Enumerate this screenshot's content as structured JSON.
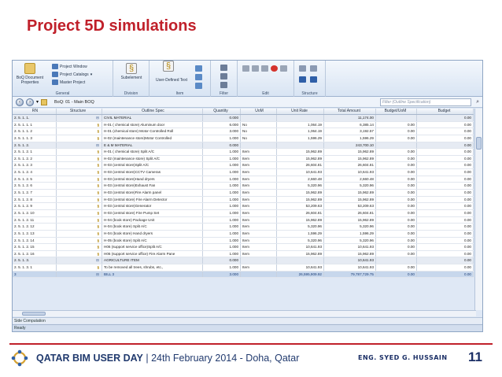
{
  "slide": {
    "title": "Project 5D simulations"
  },
  "ribbon": {
    "general": {
      "label": "General",
      "boq_props": "BoQ Document Properties",
      "project_window": "Project Window",
      "project_catalogs": "Project Catalogs",
      "master_project": "Master Project"
    },
    "division": {
      "label": "Division",
      "subelement": "Subelement"
    },
    "item": {
      "label": "Item",
      "user_defined": "User-Defined Text"
    },
    "filter": {
      "label": "Filter"
    },
    "edit": {
      "label": "Edit"
    },
    "structure": {
      "label": "Structure"
    }
  },
  "nav": {
    "breadcrumb": "BoQ: 01 - Main BOQ",
    "filter_placeholder": "Filter (Outline Specification)"
  },
  "grid": {
    "headers": [
      "RN",
      "Structure",
      "Outline Spec",
      "Quantity",
      "UoM",
      "Unit Rate",
      "Total Amount",
      "Budget/UoM",
      "Budget"
    ],
    "rows": [
      {
        "rn": "2. 5. 1. 1.",
        "st": "⊟",
        "os": "CIVIL MATERIAL",
        "qt": "0.000",
        "um": "",
        "ur": "",
        "ta": "11,174.00",
        "bu": "",
        "bg": "0.00",
        "kind": "group"
      },
      {
        "rn": "2. 5. 1. 1.  1",
        "st": "§",
        "os": "H-01 ( chemical store) Aluminum door",
        "qt": "6.000",
        "um": "No",
        "ur": "1,064.19",
        "ta": "6,385.14",
        "bu": "0.00",
        "bg": "0.00",
        "kind": "item"
      },
      {
        "rn": "2. 5. 1. 1.  2",
        "st": "§",
        "os": "H-01 (chemical store) Motor Controlled Roll",
        "qt": "3.000",
        "um": "No",
        "ur": "1,064.19",
        "ta": "3,192.57",
        "bu": "0.00",
        "bg": "0.00",
        "kind": "item"
      },
      {
        "rn": "2. 5. 1. 1.  3",
        "st": "§",
        "os": "H-02 (maintenance store)Motor Controlled",
        "qt": "1.000",
        "um": "No",
        "ur": "1,596.29",
        "ta": "1,596.29",
        "bu": "0.00",
        "bg": "0.00",
        "kind": "item"
      },
      {
        "rn": "2. 5. 1. 2.",
        "st": "⊟",
        "os": "E & M MATERIAL",
        "qt": "0.000",
        "um": "",
        "ur": "",
        "ta": "243,700.10",
        "bu": "",
        "bg": "0.00",
        "kind": "group"
      },
      {
        "rn": "2. 5. 1. 2.  1",
        "st": "§",
        "os": "H-01 ( chemical store) Split A/C",
        "qt": "1.000",
        "um": "Item",
        "ur": "15,962.89",
        "ta": "15,962.89",
        "bu": "0.00",
        "bg": "0.00",
        "kind": "item"
      },
      {
        "rn": "2. 5. 1. 2.  2",
        "st": "§",
        "os": "H-02 (maintenance store) Split A/C",
        "qt": "1.000",
        "um": "Item",
        "ur": "15,962.89",
        "ta": "15,962.89",
        "bu": "0.00",
        "bg": "0.00",
        "kind": "item"
      },
      {
        "rn": "2. 5. 1. 2.  3",
        "st": "§",
        "os": "H-03 (central store)Split A/C",
        "qt": "1.000",
        "um": "Item",
        "ur": "26,604.81",
        "ta": "26,604.81",
        "bu": "0.00",
        "bg": "0.00",
        "kind": "item"
      },
      {
        "rn": "2. 5. 1. 2.  4",
        "st": "§",
        "os": "H-03 (central store)CCTV Cameras",
        "qt": "1.000",
        "um": "Item",
        "ur": "10,641.93",
        "ta": "10,641.93",
        "bu": "0.00",
        "bg": "0.00",
        "kind": "item"
      },
      {
        "rn": "2. 5. 1. 2.  5",
        "st": "§",
        "os": "H-03 (central store)Hand dryers",
        "qt": "1.000",
        "um": "Item",
        "ur": "2,660.48",
        "ta": "2,660.48",
        "bu": "0.00",
        "bg": "0.00",
        "kind": "item"
      },
      {
        "rn": "2. 5. 1. 2.  6",
        "st": "§",
        "os": "H-03 (central store)Exhaust Fan",
        "qt": "1.000",
        "um": "Item",
        "ur": "5,320.96",
        "ta": "5,320.96",
        "bu": "0.00",
        "bg": "0.00",
        "kind": "item"
      },
      {
        "rn": "2. 5. 1. 2.  7",
        "st": "§",
        "os": "H-03 (central store)Fire Alarm panel",
        "qt": "1.000",
        "um": "Item",
        "ur": "15,962.89",
        "ta": "15,962.89",
        "bu": "0.00",
        "bg": "0.00",
        "kind": "item"
      },
      {
        "rn": "2. 5. 1. 2.  8",
        "st": "§",
        "os": "H-03 (central store) Fire Alarm Detector",
        "qt": "1.000",
        "um": "Item",
        "ur": "15,962.89",
        "ta": "15,962.89",
        "bu": "0.00",
        "bg": "0.00",
        "kind": "item"
      },
      {
        "rn": "2. 5. 1. 2.  9",
        "st": "§",
        "os": "H-03 (central store)Generator",
        "qt": "1.000",
        "um": "Item",
        "ur": "53,209.63",
        "ta": "53,209.63",
        "bu": "0.00",
        "bg": "0.00",
        "kind": "item"
      },
      {
        "rn": "2. 5. 1. 2. 10",
        "st": "§",
        "os": "H-03 (central store) Fire Pump Set",
        "qt": "1.000",
        "um": "Item",
        "ur": "26,604.81",
        "ta": "26,604.81",
        "bu": "0.00",
        "bg": "0.00",
        "kind": "item"
      },
      {
        "rn": "2. 5. 1. 2. 11",
        "st": "§",
        "os": "H-04 (book store) Package Unit",
        "qt": "1.000",
        "um": "Item",
        "ur": "15,962.89",
        "ta": "15,962.89",
        "bu": "0.00",
        "bg": "0.00",
        "kind": "item"
      },
      {
        "rn": "2. 5. 1. 2. 12",
        "st": "§",
        "os": "H-04 (book store) Split A/C",
        "qt": "1.000",
        "um": "Item",
        "ur": "5,320.96",
        "ta": "5,320.96",
        "bu": "0.00",
        "bg": "0.00",
        "kind": "item"
      },
      {
        "rn": "2. 5. 1. 2. 13",
        "st": "§",
        "os": "H-04 (book store) Hand dryers",
        "qt": "1.000",
        "um": "Item",
        "ur": "1,596.29",
        "ta": "1,596.29",
        "bu": "0.00",
        "bg": "0.00",
        "kind": "item"
      },
      {
        "rn": "2. 5. 1. 2. 14",
        "st": "§",
        "os": "H-05 (book store) Split A/C",
        "qt": "1.000",
        "um": "Item",
        "ur": "5,320.96",
        "ta": "5,320.96",
        "bu": "0.00",
        "bg": "0.00",
        "kind": "item"
      },
      {
        "rn": "2. 5. 1. 2. 15",
        "st": "§",
        "os": "H06 (support service office)Split A/C",
        "qt": "1.000",
        "um": "Item",
        "ur": "10,641.93",
        "ta": "10,641.93",
        "bu": "0.00",
        "bg": "0.00",
        "kind": "item"
      },
      {
        "rn": "2. 5. 1. 2. 16",
        "st": "§",
        "os": "H06 (support service office) Fire Alarm Pane",
        "qt": "1.000",
        "um": "Item",
        "ur": "15,962.89",
        "ta": "15,962.89",
        "bu": "0.00",
        "bg": "0.00",
        "kind": "item"
      },
      {
        "rn": "2. 5. 1. 3.",
        "st": "⊟",
        "os": "AGRICULTURE ITEM",
        "qt": "0.000",
        "um": "",
        "ur": "",
        "ta": "10,641.93",
        "bu": "",
        "bg": "0.00",
        "kind": "group"
      },
      {
        "rn": "2. 5. 1. 3.  1",
        "st": "§",
        "os": "To be removed all trees, shrubs, etc.,",
        "qt": "1.000",
        "um": "Item",
        "ur": "10,641.93",
        "ta": "10,641.93",
        "bu": "0.00",
        "bg": "0.00",
        "kind": "item"
      },
      {
        "rn": "3",
        "st": "⊟",
        "os": "BILL 3",
        "qt": "3.000",
        "um": "",
        "ur": "26,595,909.92",
        "ta": "79,787,729.75",
        "bu": "0.00",
        "bg": "0.00",
        "kind": "total"
      }
    ]
  },
  "status": {
    "side_computation": "Side Computation",
    "ready": "Ready"
  },
  "footer": {
    "event_bold": "QATAR BIM USER DAY",
    "event_rest": " | 24th February 2014 - Doha, Qatar",
    "author": "ENG. SYED G. HUSSAIN",
    "page": "11"
  },
  "colors": {
    "title_red": "#c0202a",
    "footer_blue": "#213a6e"
  }
}
